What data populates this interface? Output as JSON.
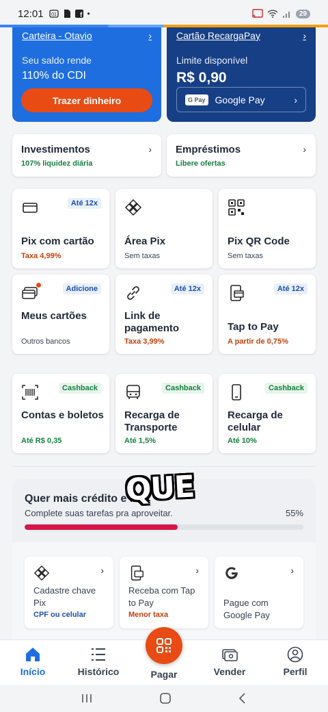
{
  "status_bar": {
    "time": "12:01",
    "battery": "29"
  },
  "carteira": {
    "title": "Carteira - Otavio",
    "label": "Seu saldo rende",
    "value": "110% do CDI",
    "button": "Trazer dinheiro"
  },
  "cartao": {
    "title": "Cartão RecargaPay",
    "label": "Limite disponível",
    "value": "R$ 0,90",
    "gpay_logo": "G Pay",
    "gpay_label": "Google Pay"
  },
  "investimentos": {
    "title": "Investimentos",
    "subtitle": "107% liquidez diária"
  },
  "emprestimos": {
    "title": "Empréstimos",
    "subtitle": "Libere ofertas"
  },
  "tiles": [
    {
      "title": "Pix com cartão",
      "subtitle": "Taxa 4,99%",
      "badge": "Até 12x"
    },
    {
      "title": "Área Pix",
      "subtitle": "Sem taxas",
      "badge": ""
    },
    {
      "title": "Pix QR Code",
      "subtitle": "Sem taxas",
      "badge": ""
    },
    {
      "title": "Meus cartões",
      "subtitle": "Outros bancos",
      "badge": "Adicione"
    },
    {
      "title": "Link de pagamento",
      "subtitle": "Taxa 3,99%",
      "badge": "Até 12x"
    },
    {
      "title": "Tap to Pay",
      "subtitle": "A partir de 0,75%",
      "badge": "Até 12x"
    },
    {
      "title": "Contas e boletos",
      "subtitle": "Até R$ 0,35",
      "badge": "Cashback"
    },
    {
      "title": "Recarga de Transporte",
      "subtitle": "Até 1,5%",
      "badge": "Cashback"
    },
    {
      "title": "Recarga de celular",
      "subtitle": "Até 10%",
      "badge": "Cashback"
    }
  ],
  "credit": {
    "title": "Quer mais crédito e li",
    "subtitle": "Complete suas tarefas pra aproveitar.",
    "percent_label": "55%",
    "progress": 0.55,
    "tasks": [
      {
        "title": "Cadastre chave Pix",
        "subtitle": "CPF ou celular"
      },
      {
        "title": "Receba com Tap to Pay",
        "subtitle": "Menor taxa"
      },
      {
        "title": "Pague com Google Pay",
        "subtitle": ""
      }
    ]
  },
  "overlay_caption": "QUE",
  "bottom_nav": {
    "inicio": "Início",
    "historico": "Histórico",
    "pagar": "Pagar",
    "vender": "Vender",
    "perfil": "Perfil"
  },
  "colors": {
    "primary": "#1e6ee0",
    "dark_blue": "#173f86",
    "accent": "#e84b14",
    "progress": "#d4164b",
    "green": "#15803d"
  }
}
